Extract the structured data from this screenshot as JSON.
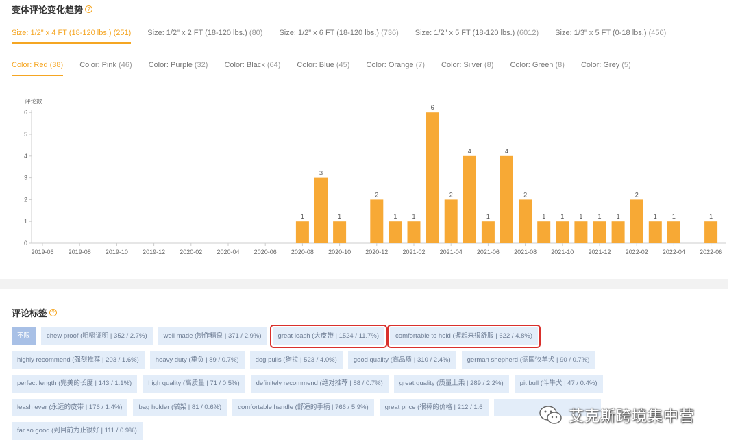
{
  "trend": {
    "title": "变体评论变化趋势",
    "size_tabs": [
      {
        "label": "Size: 1/2\" x 4 FT (18-120 lbs.)",
        "count": "(251)",
        "active": true
      },
      {
        "label": "Size: 1/2\" x 2 FT (18-120 lbs.)",
        "count": "(80)",
        "active": false
      },
      {
        "label": "Size: 1/2\" x 6 FT (18-120 lbs.)",
        "count": "(736)",
        "active": false
      },
      {
        "label": "Size: 1/2\" x 5 FT (18-120 lbs.)",
        "count": "(6012)",
        "active": false
      },
      {
        "label": "Size: 1/3\" x 5 FT (0-18 lbs.)",
        "count": "(450)",
        "active": false
      }
    ],
    "color_tabs": [
      {
        "label": "Color: Red",
        "count": "(38)",
        "active": true
      },
      {
        "label": "Color: Pink",
        "count": "(46)",
        "active": false
      },
      {
        "label": "Color: Purple",
        "count": "(32)",
        "active": false
      },
      {
        "label": "Color: Black",
        "count": "(64)",
        "active": false
      },
      {
        "label": "Color: Blue",
        "count": "(45)",
        "active": false
      },
      {
        "label": "Color: Orange",
        "count": "(7)",
        "active": false
      },
      {
        "label": "Color: Silver",
        "count": "(8)",
        "active": false
      },
      {
        "label": "Color: Green",
        "count": "(8)",
        "active": false
      },
      {
        "label": "Color: Grey",
        "count": "(5)",
        "active": false
      }
    ]
  },
  "chart_data": {
    "type": "bar",
    "ylabel": "评论数",
    "ylim": [
      0,
      6
    ],
    "yticks": [
      0,
      1,
      2,
      3,
      4,
      5,
      6
    ],
    "bar_color": "#f7a935",
    "x_tick_labels": [
      "2019-06",
      "2019-08",
      "2019-10",
      "2019-12",
      "2020-02",
      "2020-04",
      "2020-06",
      "2020-08",
      "2020-10",
      "2020-12",
      "2021-02",
      "2021-04",
      "2021-06",
      "2021-08",
      "2021-10",
      "2021-12",
      "2022-02",
      "2022-04",
      "2022-06"
    ],
    "categories": [
      "2019-06",
      "2019-07",
      "2019-08",
      "2019-09",
      "2019-10",
      "2019-11",
      "2019-12",
      "2020-01",
      "2020-02",
      "2020-03",
      "2020-04",
      "2020-05",
      "2020-06",
      "2020-07",
      "2020-08",
      "2020-09",
      "2020-10",
      "2020-11",
      "2020-12",
      "2021-01",
      "2021-02",
      "2021-03",
      "2021-04",
      "2021-05",
      "2021-06",
      "2021-07",
      "2021-08",
      "2021-09",
      "2021-10",
      "2021-11",
      "2021-12",
      "2022-01",
      "2022-02",
      "2022-03",
      "2022-04",
      "2022-05",
      "2022-06"
    ],
    "values": [
      0,
      0,
      0,
      0,
      0,
      0,
      0,
      0,
      0,
      0,
      0,
      0,
      0,
      0,
      1,
      3,
      1,
      0,
      2,
      1,
      1,
      6,
      2,
      4,
      1,
      4,
      2,
      1,
      1,
      1,
      1,
      1,
      2,
      1,
      1,
      0,
      1
    ],
    "grid": false
  },
  "tags": {
    "title": "评论标签",
    "rows": [
      [
        {
          "label": "不限",
          "selected": true,
          "highlight": false
        },
        {
          "label": "chew proof (咀嚼证明 | 352 / 2.7%)",
          "selected": false,
          "highlight": false
        },
        {
          "label": "well made (制作精良 | 371 / 2.9%)",
          "selected": false,
          "highlight": false
        },
        {
          "label": "great leash (大皮带 | 1524 / 11.7%)",
          "selected": false,
          "highlight": true
        },
        {
          "label": "comfortable to hold (握起来很舒服 | 622 / 4.8%)",
          "selected": false,
          "highlight": true
        }
      ],
      [
        {
          "label": "highly recommend (强烈推荐 | 203 / 1.6%)",
          "selected": false,
          "highlight": false
        },
        {
          "label": "heavy duty (重负 | 89 / 0.7%)",
          "selected": false,
          "highlight": false
        },
        {
          "label": "dog pulls (狗拉 | 523 / 4.0%)",
          "selected": false,
          "highlight": false
        },
        {
          "label": "good quality (高品质 | 310 / 2.4%)",
          "selected": false,
          "highlight": false
        },
        {
          "label": "german shepherd (德国牧羊犬 | 90 / 0.7%)",
          "selected": false,
          "highlight": false
        }
      ],
      [
        {
          "label": "perfect length (完美的长度 | 143 / 1.1%)",
          "selected": false,
          "highlight": false
        },
        {
          "label": "high quality (高质量 | 71 / 0.5%)",
          "selected": false,
          "highlight": false
        },
        {
          "label": "definitely recommend (绝对推荐 | 88 / 0.7%)",
          "selected": false,
          "highlight": false
        },
        {
          "label": "great quality (质量上乘 | 289 / 2.2%)",
          "selected": false,
          "highlight": false
        },
        {
          "label": "pit bull (斗牛犬 | 47 / 0.4%)",
          "selected": false,
          "highlight": false
        }
      ],
      [
        {
          "label": "leash ever (永远的皮带 | 176 / 1.4%)",
          "selected": false,
          "highlight": false
        },
        {
          "label": "bag holder (袋架 | 81 / 0.6%)",
          "selected": false,
          "highlight": false
        },
        {
          "label": "comfortable handle (舒适的手柄 | 766 / 5.9%)",
          "selected": false,
          "highlight": false
        },
        {
          "label": "great price (很棒的价格 | 212 / 1.6",
          "selected": false,
          "highlight": false
        },
        {
          "label": "",
          "selected": false,
          "highlight": false
        }
      ],
      [
        {
          "label": "far so good (到目前为止很好 | 111 / 0.9%)",
          "selected": false,
          "highlight": false
        }
      ]
    ]
  },
  "watermark": {
    "text": "艾克斯跨境集中营",
    "icon": "wechat-icon"
  }
}
